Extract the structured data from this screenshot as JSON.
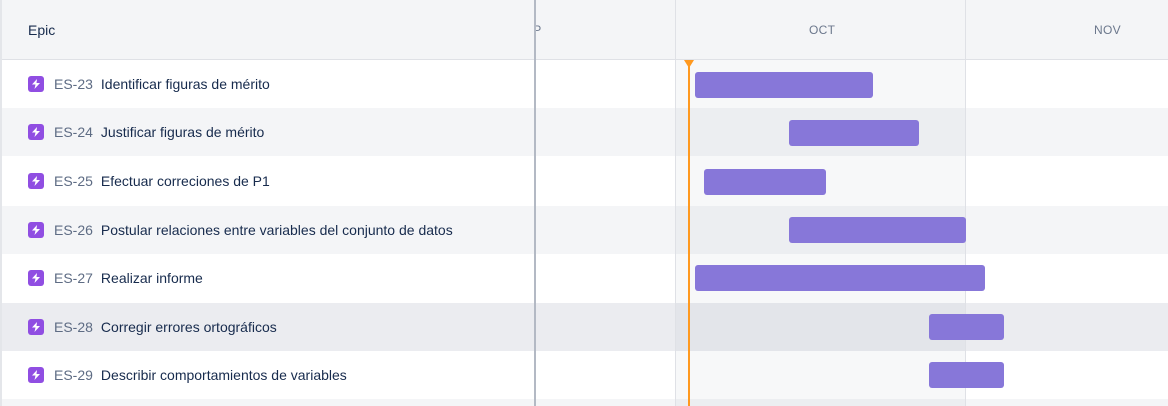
{
  "header": {
    "epic_label": "Epic",
    "months": [
      "EP",
      "OCT",
      "NOV"
    ]
  },
  "epics": [
    {
      "key": "ES-23",
      "title": "Identificar figuras de mérito"
    },
    {
      "key": "ES-24",
      "title": "Justificar figuras de mérito"
    },
    {
      "key": "ES-25",
      "title": "Efectuar correciones de P1"
    },
    {
      "key": "ES-26",
      "title": "Postular relaciones entre variables del conjunto de datos"
    },
    {
      "key": "ES-27",
      "title": "Realizar informe"
    },
    {
      "key": "ES-28",
      "title": "Corregir errores ortográficos"
    },
    {
      "key": "ES-29",
      "title": "Describir comportamientos de variables"
    }
  ],
  "colors": {
    "epic_icon": "#904ee2",
    "bar": "#8777d9",
    "today_marker": "#ff991f"
  },
  "icons": {
    "epic": "lightning-bolt-icon"
  }
}
